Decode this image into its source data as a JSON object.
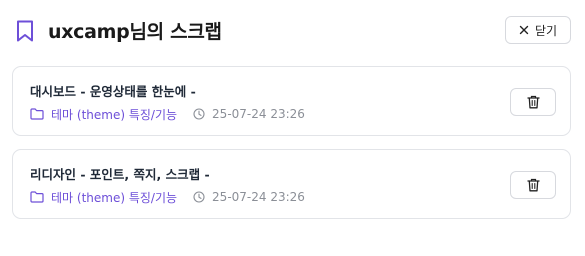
{
  "header": {
    "title": "uxcamp님의 스크랩",
    "close_label": "닫기"
  },
  "icons": {
    "title": "bookmark-icon",
    "close": "close-icon",
    "category": "folder-icon",
    "date": "clock-icon",
    "delete": "trash-icon"
  },
  "colors": {
    "accent": "#6d4fd8",
    "meta_text": "#8b8f97",
    "border": "#e2e4e8"
  },
  "scraps": [
    {
      "title": "대시보드 - 운영상태를 한눈에 -",
      "category": "테마 (theme) 특징/기능",
      "date": "25-07-24 23:26"
    },
    {
      "title": "리디자인 - 포인트, 쪽지, 스크랩 -",
      "category": "테마 (theme) 특징/기능",
      "date": "25-07-24 23:26"
    }
  ]
}
